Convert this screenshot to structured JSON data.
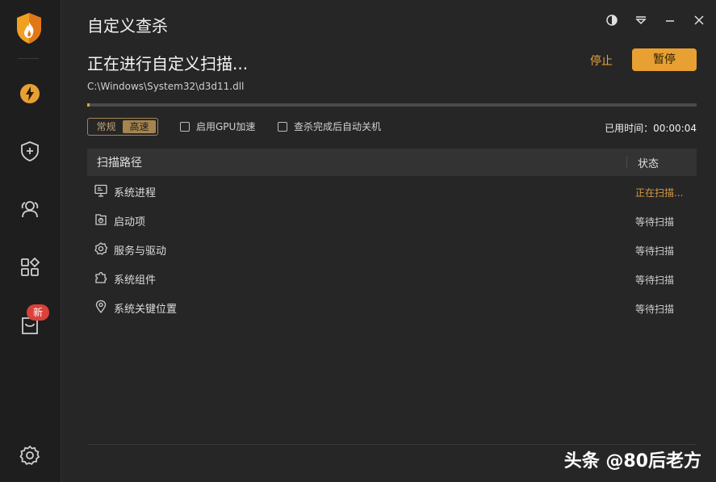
{
  "app": {
    "logo": "shield-flame-logo",
    "brand_color": "#e8a033",
    "new_badge": "新"
  },
  "sidebar": {
    "items": [
      {
        "icon": "lightning-icon",
        "name": "quick-scan",
        "active": true
      },
      {
        "icon": "shield-plus-icon",
        "name": "protection"
      },
      {
        "icon": "users-icon",
        "name": "accounts"
      },
      {
        "icon": "apps-icon",
        "name": "tools"
      },
      {
        "icon": "store-icon",
        "name": "store",
        "badge": "新"
      },
      {
        "icon": "gear-icon",
        "name": "settings"
      }
    ]
  },
  "window": {
    "title": "自定义查杀",
    "controls": [
      "theme-icon",
      "menu-icon",
      "minimize-icon",
      "close-icon"
    ]
  },
  "scan": {
    "heading": "正在进行自定义扫描...",
    "current_file": "C:\\Windows\\System32\\d3d11.dll",
    "progress": 0.004,
    "stop_label": "停止",
    "pause_label": "暂停"
  },
  "options": {
    "mode_normal": "常规",
    "mode_fast": "高速",
    "gpu_label": "启用GPU加速",
    "shutdown_label": "查杀完成后自动关机",
    "elapsed_label": "已用时间：",
    "elapsed_value": "00:00:04"
  },
  "table": {
    "header_path": "扫描路径",
    "header_status": "状态",
    "rows": [
      {
        "icon": "monitor-icon",
        "label": "系统进程",
        "status": "正在扫描..."
      },
      {
        "icon": "startup-icon",
        "label": "启动项",
        "status": "等待扫描"
      },
      {
        "icon": "service-icon",
        "label": "服务与驱动",
        "status": "等待扫描"
      },
      {
        "icon": "puzzle-icon",
        "label": "系统组件",
        "status": "等待扫描"
      },
      {
        "icon": "location-icon",
        "label": "系统关键位置",
        "status": "等待扫描"
      }
    ]
  },
  "watermark": "头条 @80后老方"
}
